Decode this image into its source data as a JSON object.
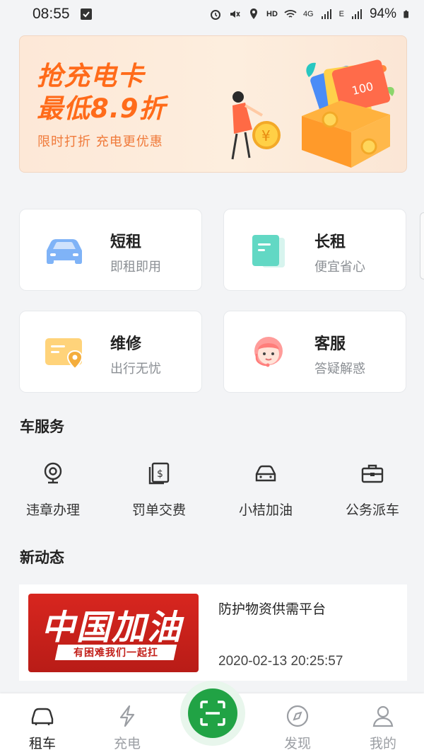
{
  "status_bar": {
    "time": "08:55",
    "signal_4g": "4G",
    "signal_e": "E",
    "battery": "94%"
  },
  "banner": {
    "headline_line1": "抢充电卡",
    "headline_line2": "最低8.9折",
    "subtext": "限时打折  充电更优惠",
    "art_card_text": "100"
  },
  "quick_cards": [
    {
      "title": "短租",
      "desc": "即租即用",
      "icon": "car-icon"
    },
    {
      "title": "长租",
      "desc": "便宜省心",
      "icon": "document-icon"
    },
    {
      "title": "维修",
      "desc": "出行无忧",
      "icon": "location-card-icon"
    },
    {
      "title": "客服",
      "desc": "答疑解惑",
      "icon": "customer-service-icon"
    }
  ],
  "car_services": {
    "title": "车服务",
    "items": [
      {
        "label": "违章办理",
        "icon": "camera-icon"
      },
      {
        "label": "罚单交费",
        "icon": "money-bill-icon"
      },
      {
        "label": "小桔加油",
        "icon": "car-front-icon"
      },
      {
        "label": "公务派车",
        "icon": "briefcase-icon"
      }
    ]
  },
  "news": {
    "title": "新动态",
    "items": [
      {
        "image_text": "中国加油",
        "image_subtext": "有困难我们一起扛",
        "headline": "防护物资供需平台",
        "time": "2020-02-13 20:25:57"
      }
    ]
  },
  "tabbar": {
    "tabs": [
      {
        "label": "租车",
        "icon": "car-tab-icon",
        "active": true
      },
      {
        "label": "充电",
        "icon": "lightning-icon",
        "active": false
      },
      {
        "label": "发现",
        "icon": "compass-icon",
        "active": false
      },
      {
        "label": "我的",
        "icon": "person-icon",
        "active": false
      }
    ],
    "scan_icon": "scan-icon"
  },
  "colors": {
    "accent_green": "#21a345",
    "banner_orange": "#ff6b1a"
  }
}
